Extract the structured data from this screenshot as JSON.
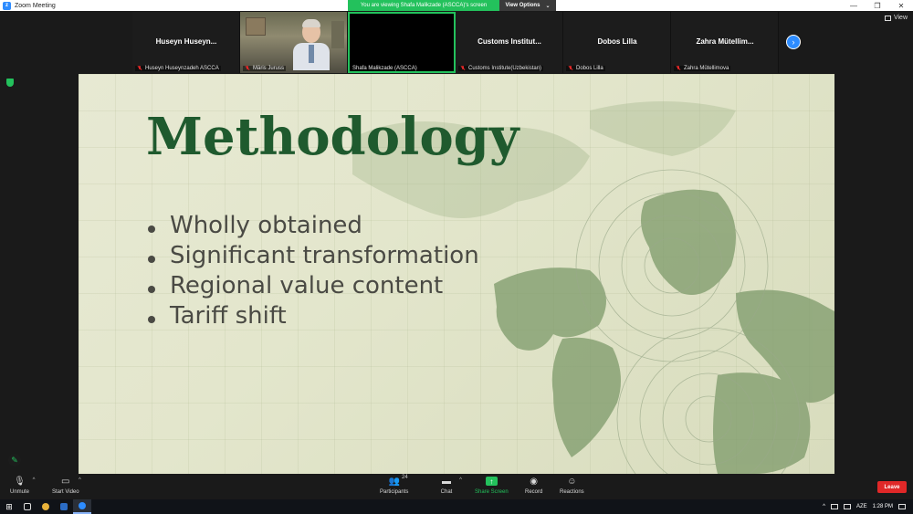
{
  "window": {
    "title": "Zoom Meeting",
    "minimize": "—",
    "maximize": "❐",
    "close": "✕"
  },
  "share_banner": {
    "text": "You are viewing Shafa Malikzade (ASCCA)'s screen",
    "view_options": "View Options"
  },
  "view_button": {
    "label": "View"
  },
  "participants_strip": [
    {
      "display_name": "Huseyn  Huseyn...",
      "label": "Huseyn Huseynzadeh ASCCA",
      "muted": true,
      "video": false
    },
    {
      "display_name": "",
      "label": "Māris Juruss",
      "muted": true,
      "video": true
    },
    {
      "display_name": "",
      "label": "Shafa Malikzade (ASCCA)",
      "muted": false,
      "video": false,
      "active": true
    },
    {
      "display_name": "Customs Institut...",
      "label": "Customs Institute(Uzbekistan)",
      "muted": true,
      "video": false
    },
    {
      "display_name": "Dobos Lilla",
      "label": "Dobos Lilla",
      "muted": true,
      "video": false
    },
    {
      "display_name": "Zahra  Mütellim...",
      "label": "Zahra Mütellimova",
      "muted": true,
      "video": false
    }
  ],
  "slide": {
    "heading": "Methodology",
    "bullets": [
      "Wholly obtained",
      "Significant transformation",
      "Regional value content",
      "Tariff shift"
    ]
  },
  "toolbar": {
    "unmute": "Unmute",
    "start_video": "Start Video",
    "participants": "Participants",
    "participants_count": "24",
    "chat": "Chat",
    "share_screen": "Share Screen",
    "record": "Record",
    "reactions": "Reactions",
    "leave": "Leave"
  },
  "taskbar": {
    "language": "AZE",
    "time": "1:28 PM"
  },
  "colors": {
    "zoom_blue": "#2d8cff",
    "share_green": "#23c15c",
    "leave_red": "#e02828",
    "heading_green": "#1f5a2e"
  }
}
